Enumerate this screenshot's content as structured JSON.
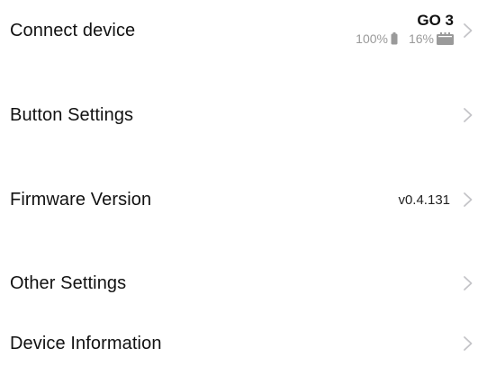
{
  "rows": [
    {
      "label": "Connect device"
    },
    {
      "label": "Button Settings"
    },
    {
      "label": "Firmware Version",
      "value": "v0.4.131"
    },
    {
      "label": "Other Settings"
    },
    {
      "label": "Device Information"
    }
  ],
  "device": {
    "name": "GO 3",
    "battery_percent": "100%",
    "storage_percent": "16%",
    "battery_icon": "battery-icon",
    "storage_icon": "sd-card-icon"
  },
  "colors": {
    "text": "#111111",
    "secondary": "#9a9a9a",
    "chevron": "#c4c4c8"
  }
}
